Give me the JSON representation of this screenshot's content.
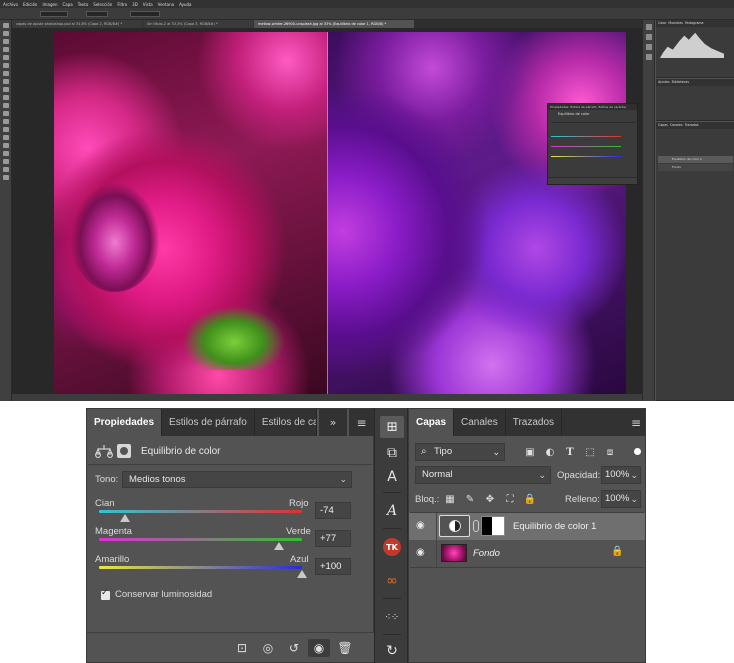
{
  "top_screenshot": {
    "menu": [
      "Archivo",
      "Edición",
      "Imagen",
      "Capa",
      "Texto",
      "Selección",
      "Filtro",
      "3D",
      "Vista",
      "Ventana",
      "Ayuda"
    ],
    "doc_tabs": [
      "capas de ajuste photoshop.psd al 34,8% (Capa 2, RGB/8#) *",
      "Sin título-2 al 33,3% (Capa 3, RGB/8#) *",
      "mellow-winter-26900-unsplash.jpg al 33% (Equilibrio de color 1, RGB/8) *"
    ],
    "dock_tabs_1": [
      "Color",
      "Muestras",
      "Histograma"
    ],
    "dock_tabs_2": [
      "Ajustes",
      "Bibliotecas"
    ],
    "dock_tabs_3": [
      "Capas",
      "Canales",
      "Trazados"
    ],
    "mini_layers": [
      "Equilibrio de color 1",
      "Fondo"
    ],
    "float_panel_tabs": [
      "Propiedades",
      "Estilos de párrafo",
      "Estilos de carácter"
    ],
    "float_panel_title": "Equilibrio de color"
  },
  "properties": {
    "tabs": [
      "Propiedades",
      "Estilos de párrafo",
      "Estilos de carácter"
    ],
    "more_icon": "double-chevron-right-icon",
    "menu_icon": "hamburger-icon",
    "title": "Equilibrio de color",
    "tone_label": "Tono:",
    "tone_value": "Medios tonos",
    "sliders": [
      {
        "left": "Cian",
        "right": "Rojo",
        "value": "-74",
        "fraction": 0.13,
        "from": "#2ec6d6",
        "to": "#e03030"
      },
      {
        "left": "Magenta",
        "right": "Verde",
        "value": "+77",
        "fraction": 0.885,
        "from": "#e02fd6",
        "to": "#30c030"
      },
      {
        "left": "Amarillo",
        "right": "Azul",
        "value": "+100",
        "fraction": 1.0,
        "from": "#e8e838",
        "to": "#2a2ae0"
      }
    ],
    "preserve_label": "Conservar luminosidad",
    "preserve_checked": true
  },
  "layers": {
    "tabs": [
      "Capas",
      "Canales",
      "Trazados"
    ],
    "filter_kind": "Tipo",
    "blend_mode": "Normal",
    "opacity_label": "Opacidad:",
    "opacity_value": "100%",
    "lock_label": "Bloq.:",
    "fill_label": "Relleno:",
    "fill_value": "100%",
    "items": [
      {
        "name": "Equilibrio de color 1",
        "selected": true,
        "italic": false
      },
      {
        "name": "Fondo",
        "selected": false,
        "italic": true
      }
    ]
  }
}
